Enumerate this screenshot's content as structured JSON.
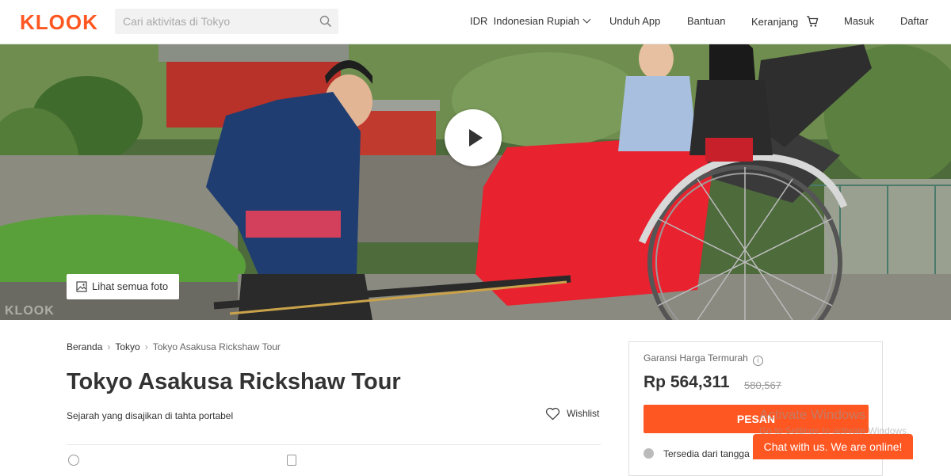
{
  "header": {
    "logo": "KLOOK",
    "search_placeholder": "Cari aktivitas di Tokyo",
    "currency": "IDR  Indonesian Rupiah",
    "download_app": "Unduh App",
    "help": "Bantuan",
    "cart": "Keranjang",
    "login": "Masuk",
    "register": "Daftar"
  },
  "hero": {
    "view_photos": "Lihat semua foto",
    "watermark": "KLOOK"
  },
  "breadcrumb": {
    "items": [
      "Beranda",
      "Tokyo",
      "Tokyo Asakusa Rickshaw Tour"
    ]
  },
  "activity": {
    "title": "Tokyo Asakusa Rickshaw Tour",
    "subtitle": "Sejarah yang disajikan di tahta portabel",
    "wishlist": "Wishlist"
  },
  "booking": {
    "guarantee": "Garansi Harga Termurah",
    "price": "Rp 564,311",
    "old_price": "580,567",
    "book_button": "PESAN",
    "availability": "Tersedia dari tangga"
  },
  "overlay": {
    "activate_title": "Activate Windows",
    "activate_sub": "Go to Settings to activate Windows.",
    "chat": "Chat with us. We are online!"
  },
  "colors": {
    "accent": "#ff5722"
  }
}
